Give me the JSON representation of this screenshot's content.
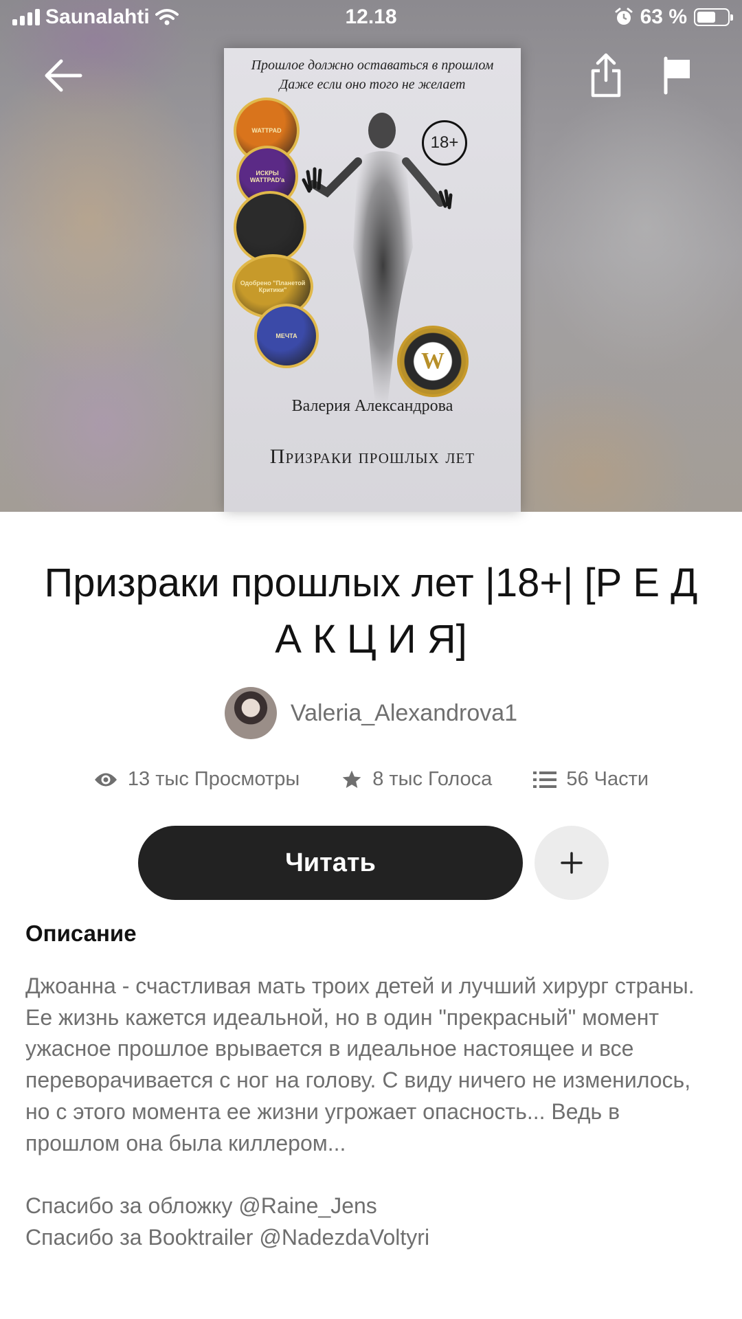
{
  "status_bar": {
    "carrier": "Saunalahti",
    "time": "12.18",
    "battery": "63 %",
    "battery_level": 0.63
  },
  "cover": {
    "tagline_1": "Прошлое должно оставаться в прошлом",
    "tagline_2": "Даже если оно того не желает",
    "age_rating": "18+",
    "badges": [
      {
        "text": "WATTPAD",
        "color": "#d9741c"
      },
      {
        "text": "ИСКРЫ WATTPAD'а",
        "color": "#5b2a86"
      },
      {
        "text": "",
        "color": "#2b2b2b"
      },
      {
        "text": "Одобрено \"Планетой Критики\"",
        "color": "#c79a2a"
      },
      {
        "text": "МЕЧТА",
        "color": "#3b4aa8"
      },
      {
        "text": "W",
        "color": "#b8902a"
      }
    ],
    "author": "Валерия Александрова",
    "title": "Призраки прошлых лет"
  },
  "story": {
    "title": "Призраки прошлых лет |18+| [Р Е Д А К Ц И Я]",
    "author": "Valeria_Alexandrova1",
    "views": "13 тыс Просмотры",
    "votes": "8 тыс Голоса",
    "parts": "56 Части"
  },
  "actions": {
    "read_label": "Читать",
    "add_symbol": "+"
  },
  "description": {
    "heading": "Описание",
    "text": "Джоанна - счастливая мать троих детей и лучший хирург страны. Ее жизнь кажется идеальной, но в один \"прекрасный\" момент ужасное прошлое врывается в идеальное настоящее и все переворачивается с ног на голову. С виду ничего не изменилось, но с этого момента ее жизни угрожает опасность... Ведь в прошлом она была киллером...\n\nСпасибо за обложку @Raine_Jens\nСпасибо за Booktrailer @NadezdaVoltyri"
  },
  "colors": {
    "primary_button": "#222222",
    "secondary_button": "#ececec",
    "muted_text": "#6f6f6f"
  }
}
